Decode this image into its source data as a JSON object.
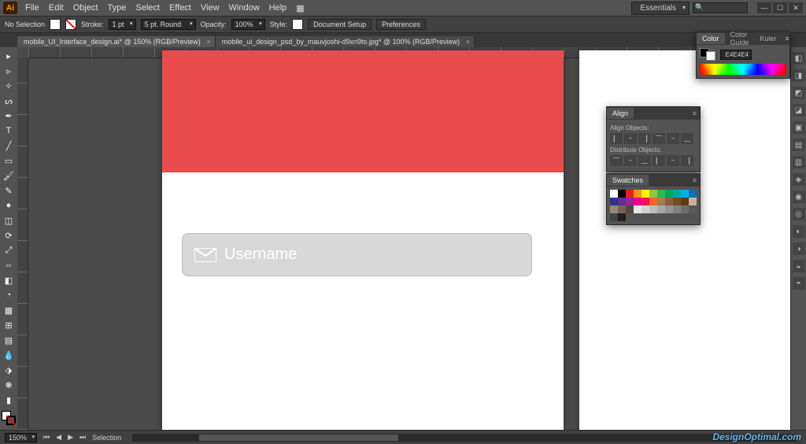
{
  "app": {
    "logo": "Ai"
  },
  "menu": {
    "items": [
      "File",
      "Edit",
      "Object",
      "Type",
      "Select",
      "Effect",
      "View",
      "Window",
      "Help"
    ]
  },
  "workspace": {
    "name": "Essentials"
  },
  "window_controls": {
    "min": "—",
    "max": "☐",
    "close": "✕"
  },
  "controlbar": {
    "no_selection": "No Selection",
    "stroke_label": "Stroke:",
    "stroke_weight": "1 pt",
    "brush": "5 pt. Round",
    "opacity_label": "Opacity:",
    "opacity": "100%",
    "style_label": "Style:",
    "doc_setup": "Document Setup",
    "preferences": "Preferences"
  },
  "tabs": [
    {
      "label": "mobile_UI_Interface_design.ai* @ 150% (RGB/Preview)",
      "active": true
    },
    {
      "label": "mobile_ui_design_psd_by_mauvjoshi-d9xn9to.jpg* @ 100% (RGB/Preview)",
      "active": false
    }
  ],
  "artboard": {
    "field_label": "Username",
    "red": "#e84c4c"
  },
  "panels": {
    "color": {
      "tabs": [
        "Color",
        "Color Guide",
        "Kuler"
      ],
      "hex": "E4E4E4"
    },
    "align": {
      "title": "Align",
      "section1": "Align Objects:",
      "section2": "Distribute Objects:",
      "align_btns": [
        "▏",
        "⎯",
        "▕",
        "⎺",
        "⎯",
        "⎽"
      ],
      "dist_btns": [
        "⎺",
        "⎯",
        "⎽",
        "▏",
        "⎯",
        "▕"
      ]
    },
    "swatches": {
      "title": "Swatches",
      "colors": [
        "#ffffff",
        "#000000",
        "#ed1c24",
        "#f7941e",
        "#fff200",
        "#8dc63f",
        "#39b54a",
        "#00a651",
        "#00a99d",
        "#00aeef",
        "#0072bc",
        "#2e3192",
        "#662d91",
        "#92278f",
        "#ec008c",
        "#ed145b",
        "#f26522",
        "#a67c52",
        "#8b5e3c",
        "#754c29",
        "#603913",
        "#c7b299",
        "#998675",
        "#736357",
        "#534741",
        "#e6e7e8",
        "#d1d3d4",
        "#bcbec0",
        "#a7a9ac",
        "#939598",
        "#808285",
        "#6d6e71",
        "#58595b",
        "#414042",
        "#231f20"
      ]
    }
  },
  "right_icons": [
    "◧",
    "◨",
    "◩",
    "◪",
    "▣",
    "▤",
    "▥",
    "◈",
    "◉",
    "◎",
    "◐",
    "◑",
    "◒",
    "◓"
  ],
  "status": {
    "zoom": "150%",
    "tool": "Selection",
    "nav": [
      "⏮",
      "◀",
      "▶",
      "⏭"
    ]
  },
  "watermark": "DesignOptimal.com"
}
